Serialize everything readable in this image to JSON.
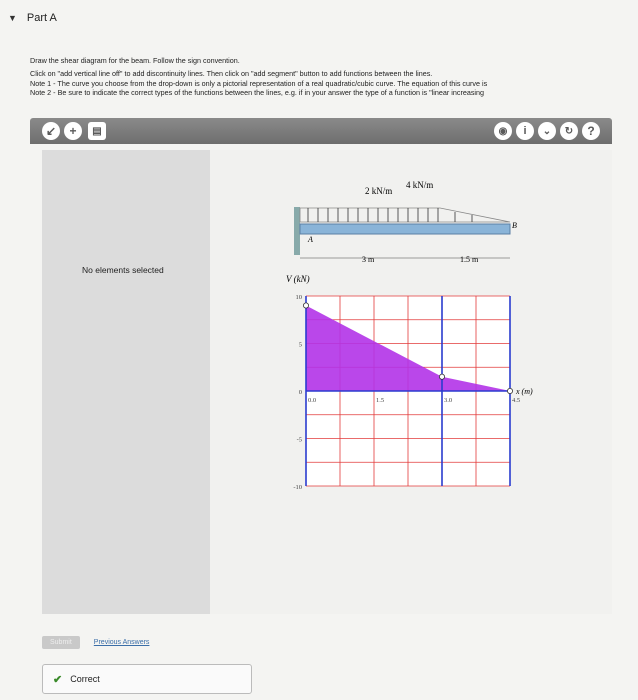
{
  "part": {
    "title": "Part A"
  },
  "instructions": {
    "line1": "Draw the shear diagram for the beam. Follow the sign convention.",
    "line2": "Click on \"add vertical line off\" to add discontinuity lines. Then click on \"add segment\" button to add functions between the lines.",
    "line3": "Note 1 - The curve you choose from the drop-down is only a pictorial representation of a real quadratic/cubic curve. The equation of this curve is",
    "line4": "Note 2 - Be sure to indicate the correct types of the functions between the lines, e.g. if in your answer the type of a function is \"linear increasing"
  },
  "left_panel": {
    "message": "No elements selected"
  },
  "beam": {
    "load_left": "2 kN/m",
    "load_right": "4 kN/m",
    "support_a": "A",
    "support_b": "B",
    "dim_1": "3 m",
    "dim_2": "1.5 m"
  },
  "plot": {
    "ylabel": "V (kN)",
    "xlabel": "x (m)",
    "y_ticks": [
      "10",
      "5",
      "0",
      "-5",
      "-10"
    ],
    "x_ticks": [
      "0.0",
      "1.5",
      "3.0",
      "4.5"
    ]
  },
  "chart_data": {
    "type": "area",
    "x": [
      0,
      3,
      4.5
    ],
    "values": [
      9,
      1.5,
      0
    ],
    "xlabel": "x (m)",
    "ylabel": "V (kN)",
    "ylim": [
      -10,
      10
    ],
    "xlim": [
      0,
      4.5
    ],
    "fill_color": "#b233e8",
    "grid": true
  },
  "bottom": {
    "submit": "Submit",
    "previous_answers": "Previous Answers",
    "feedback": "Correct"
  },
  "colors": {
    "accent_fill": "#b233e8",
    "grid_line": "#e23a3a",
    "axis_line": "#2a3ccf"
  }
}
